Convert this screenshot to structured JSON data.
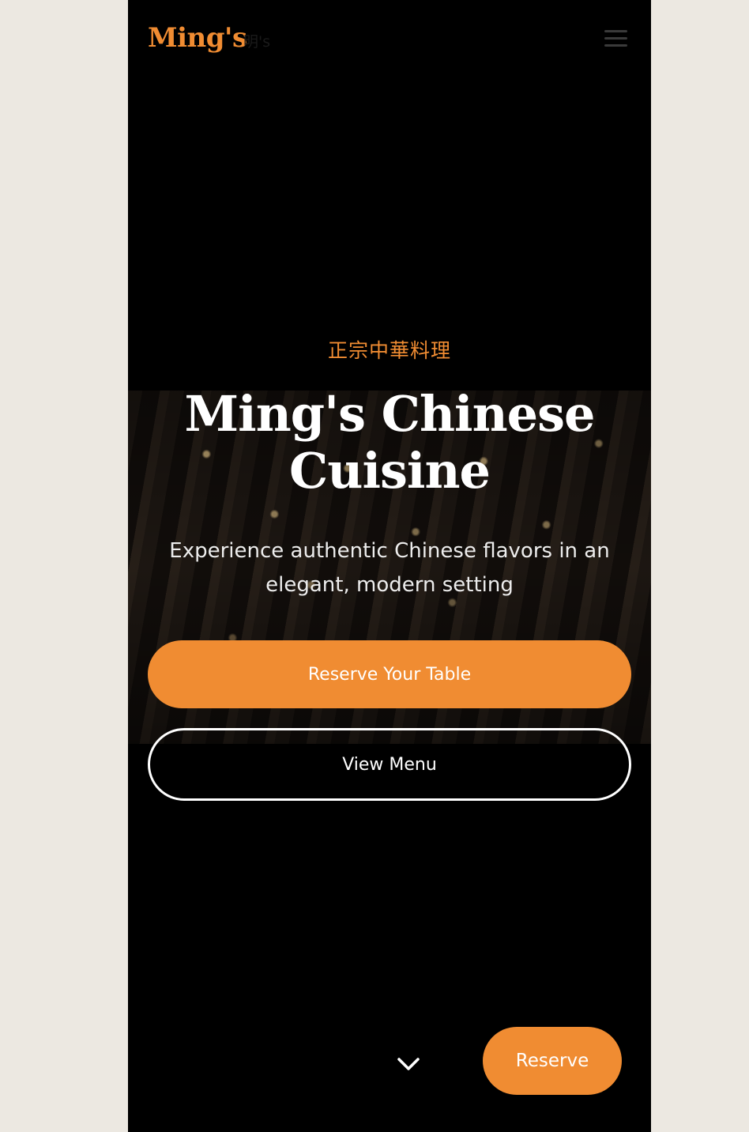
{
  "header": {
    "logo": "Ming's",
    "logo_sub": "明's",
    "menu_icon": "hamburger-menu-icon"
  },
  "hero": {
    "eyebrow": "正宗中華料理",
    "title": "Ming's Chinese Cuisine",
    "subtitle": "Experience authentic Chinese flavors in an elegant, modern setting",
    "primary_button": "Reserve Your Table",
    "secondary_button": "View Menu",
    "scroll_icon": "chevron-down-icon"
  },
  "floating": {
    "reserve_button": "Reserve"
  },
  "colors": {
    "accent": "#f08c32",
    "background": "#000000",
    "page": "#ece8e1",
    "text": "#ffffff"
  }
}
